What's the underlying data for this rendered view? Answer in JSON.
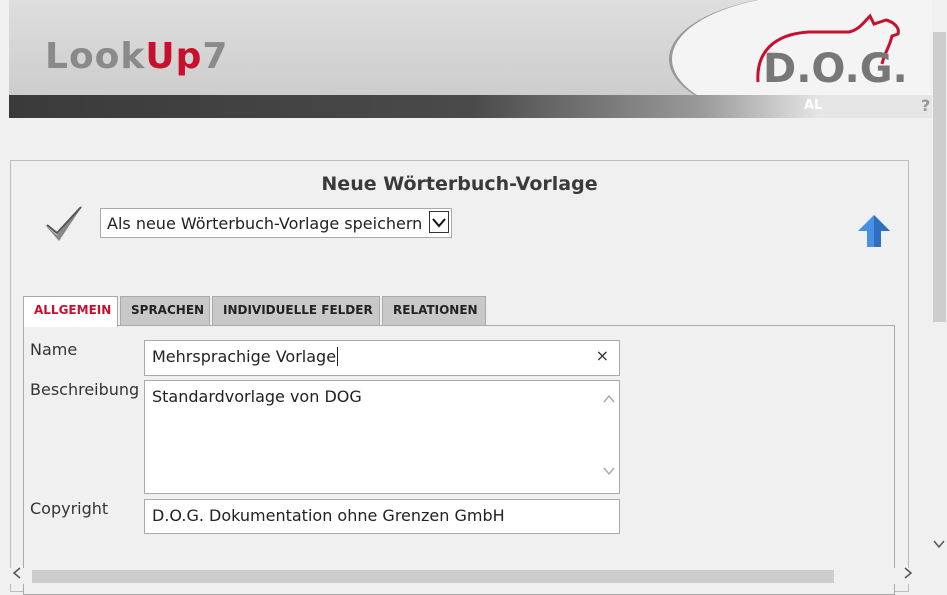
{
  "header": {
    "logo_part1": "Look",
    "logo_part2": "Up",
    "logo_part3": "7",
    "brand_text": "D.O.G.",
    "bar_label": "AL",
    "help_label": "?",
    "colors": {
      "accent": "#c8102e",
      "logo_gray": "#8a8a8a"
    }
  },
  "panel": {
    "title": "Neue Wörterbuch-Vorlage",
    "action_select": {
      "value": "Als neue Wörterbuch-Vorlage speichern"
    }
  },
  "tabs": [
    {
      "label": "ALLGEMEIN",
      "active": true
    },
    {
      "label": "SPRACHEN",
      "active": false
    },
    {
      "label": "INDIVIDUELLE FELDER",
      "active": false
    },
    {
      "label": "RELATIONEN",
      "active": false
    }
  ],
  "form": {
    "name_label": "Name",
    "name_value": "Mehrsprachige Vorlage",
    "clear_symbol": "×",
    "description_label": "Beschreibung",
    "description_value": "Standardvorlage von DOG",
    "copyright_label": "Copyright",
    "copyright_value": "D.O.G. Dokumentation ohne Grenzen GmbH"
  },
  "icons": {
    "save": "checkmark-icon",
    "upload": "up-arrow-icon",
    "clear": "close-icon",
    "help": "help-icon"
  }
}
